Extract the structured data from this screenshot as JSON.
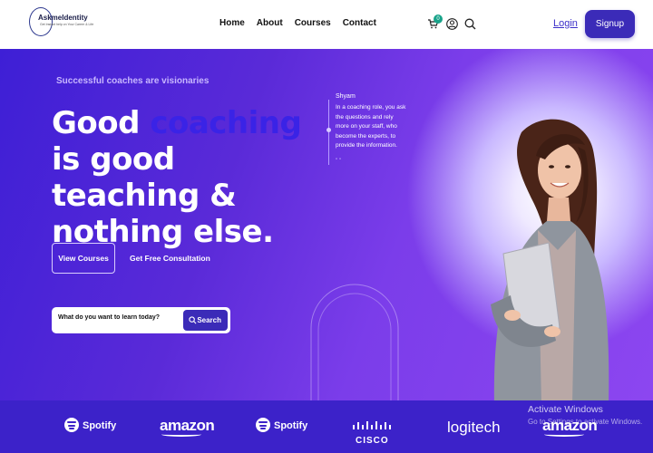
{
  "header": {
    "logo": {
      "name": "AskmeIdentity",
      "tagline": "Get Instant help on Your Career & Life"
    },
    "nav": [
      "Home",
      "About",
      "Courses",
      "Contact"
    ],
    "cart_count": "0",
    "login_label": "Login",
    "signup_label": "Signup",
    "icons": [
      "cart-icon",
      "user-icon",
      "search-icon"
    ],
    "accent_color": "#3b2bb8"
  },
  "hero": {
    "eyebrow": "Successful coaches are visionaries",
    "headline_part1": "Good ",
    "headline_accent": "coaching",
    "headline_part2": " is good teaching & nothing else.",
    "quote": {
      "author": "Shyam",
      "text": "In a coaching role, you ask the questions and rely more on your staff, who become the experts, to provide the information.",
      "mark": "\" \""
    },
    "view_courses_label": "View Courses",
    "consultation_label": "Get Free Consultation",
    "search_placeholder": "What do you want to learn today?",
    "search_button_label": "Search",
    "background_colors": [
      "#3e1fd6",
      "#8c46f0"
    ]
  },
  "partners": {
    "brands": [
      "Spotify",
      "amazon",
      "Spotify",
      "CISCO",
      "logitech",
      "amazon"
    ],
    "strip_color": "#3c22c9"
  },
  "watermark": {
    "title": "Activate Windows",
    "subtitle": "Go to Settings to activate Windows."
  }
}
